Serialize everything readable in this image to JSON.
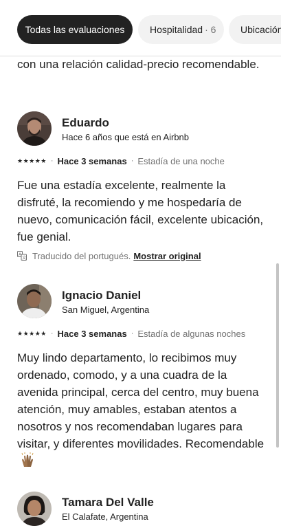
{
  "filters": {
    "all_label": "Todas las evaluaciones",
    "hospitality_label": "Hospitalidad",
    "hospitality_count": "· 6",
    "location_label": "Ubicación"
  },
  "reviews": [
    {
      "text": "con una relación calidad-precio recomendable."
    },
    {
      "name": "Eduardo",
      "subtitle": "Hace 6 años que está en Airbnb",
      "stars": "★★★★★",
      "separator": "·",
      "when": "Hace 3 semanas",
      "stay": "Estadía de una noche",
      "text": "Fue una estadía excelente, realmente la disfruté, la recomiendo y me hospedaría de nuevo, comunicación fácil, excelente ubicación, fue genial.",
      "translated_note": "Traducido del portugués.",
      "show_original": "Mostrar original"
    },
    {
      "name": "Ignacio Daniel",
      "subtitle": "San Miguel, Argentina",
      "stars": "★★★★★",
      "separator": "·",
      "when": "Hace 3 semanas",
      "stay": "Estadía de algunas noches",
      "text": "Muy lindo departamento, lo recibimos muy ordenado, comodo, y a una cuadra de la avenida principal, cerca del centro, muy buena atención, muy amables, estaban atentos a nosotros y nos recomendaban lugares para visitar, y diferentes movilidades. Recomendable",
      "emoji": "raised-hands-emoji"
    },
    {
      "name": "Tamara Del Valle",
      "subtitle": "El Calafate, Argentina"
    }
  ]
}
